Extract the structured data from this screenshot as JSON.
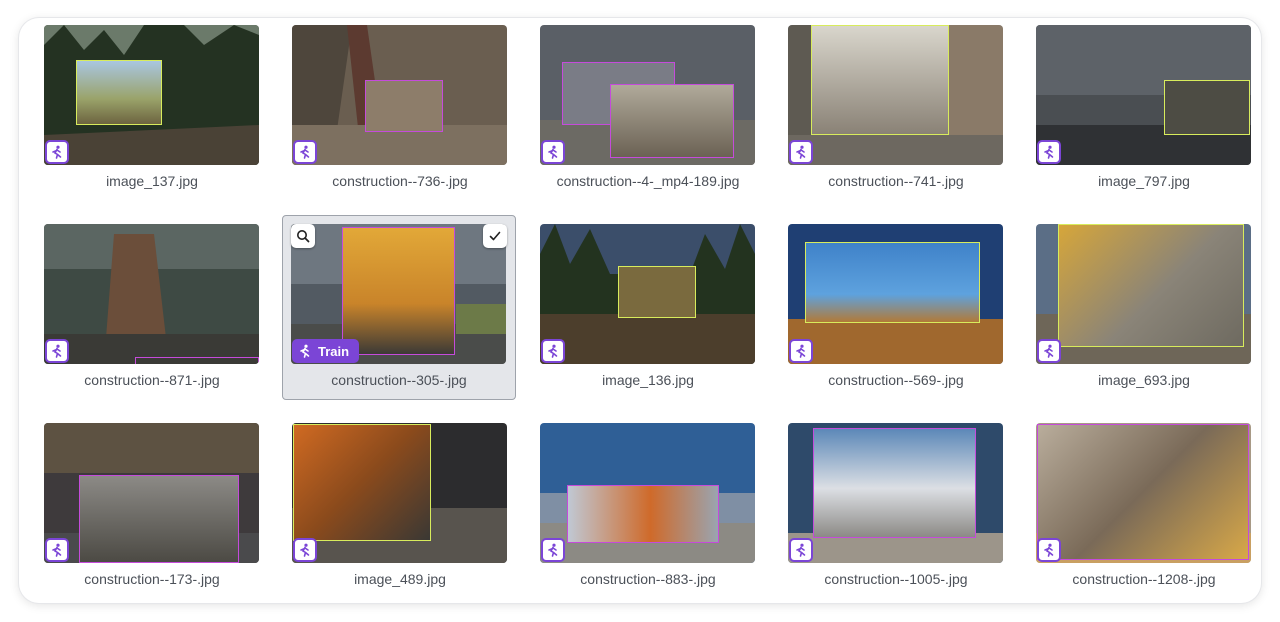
{
  "colors": {
    "accent": "#7b45d6",
    "bbox_lime": "#d8ec5c",
    "bbox_purple": "#c54bdb",
    "caption_text": "#4b5058",
    "selected_bg": "#e4e6ea"
  },
  "icons": {
    "tag": "runner-icon",
    "preview": "magnifier-icon",
    "select": "checkmark-icon"
  },
  "selected_item": {
    "tag_label": "Train"
  },
  "gallery": [
    {
      "filename": "image_137.jpg"
    },
    {
      "filename": "construction--736-.jpg"
    },
    {
      "filename": "construction--4-_mp4-189.jpg"
    },
    {
      "filename": "construction--741-.jpg"
    },
    {
      "filename": "image_797.jpg"
    },
    {
      "filename": "construction--871-.jpg"
    },
    {
      "filename": "construction--305-.jpg"
    },
    {
      "filename": "image_136.jpg"
    },
    {
      "filename": "construction--569-.jpg"
    },
    {
      "filename": "image_693.jpg"
    },
    {
      "filename": "construction--173-.jpg"
    },
    {
      "filename": "image_489.jpg"
    },
    {
      "filename": "construction--883-.jpg"
    },
    {
      "filename": "construction--1005-.jpg"
    },
    {
      "filename": "construction--1208-.jpg"
    }
  ]
}
